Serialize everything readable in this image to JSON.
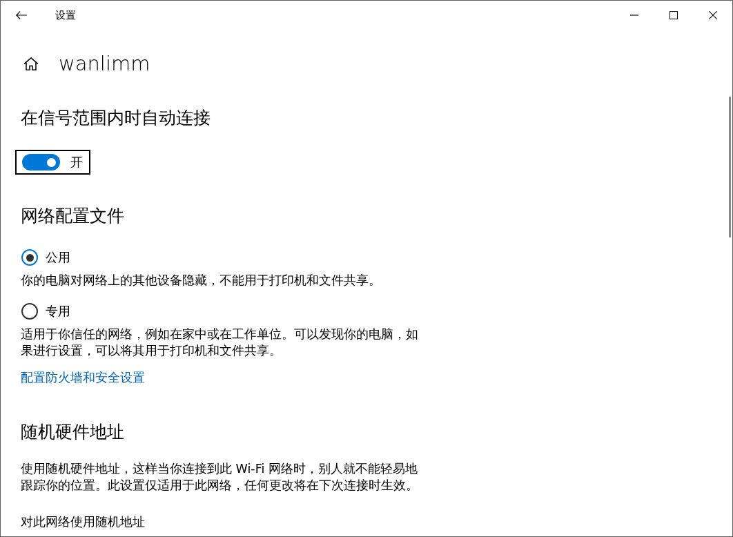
{
  "window": {
    "title": "设置"
  },
  "header": {
    "network_name": "wanlimm"
  },
  "auto_connect": {
    "heading": "在信号范围内时自动连接",
    "toggle": {
      "on": true,
      "focused": true,
      "label": "开"
    }
  },
  "network_profile": {
    "heading": "网络配置文件",
    "options": [
      {
        "label": "公用",
        "selected": true,
        "description": "你的电脑对网络上的其他设备隐藏，不能用于打印机和文件共享。"
      },
      {
        "label": "专用",
        "selected": false,
        "description": "适用于你信任的网络，例如在家中或在工作单位。可以发现你的电脑，如果进行设置，可以将其用于打印机和文件共享。"
      }
    ],
    "link": "配置防火墙和安全设置"
  },
  "random_hardware_address": {
    "heading": "随机硬件地址",
    "description": "使用随机硬件地址，这样当你连接到此 Wi-Fi 网络时，别人就不能轻易地跟踪你的位置。此设置仅适用于此网络，任何更改将在下次连接时生效。",
    "setting_label": "对此网络使用随机地址"
  }
}
